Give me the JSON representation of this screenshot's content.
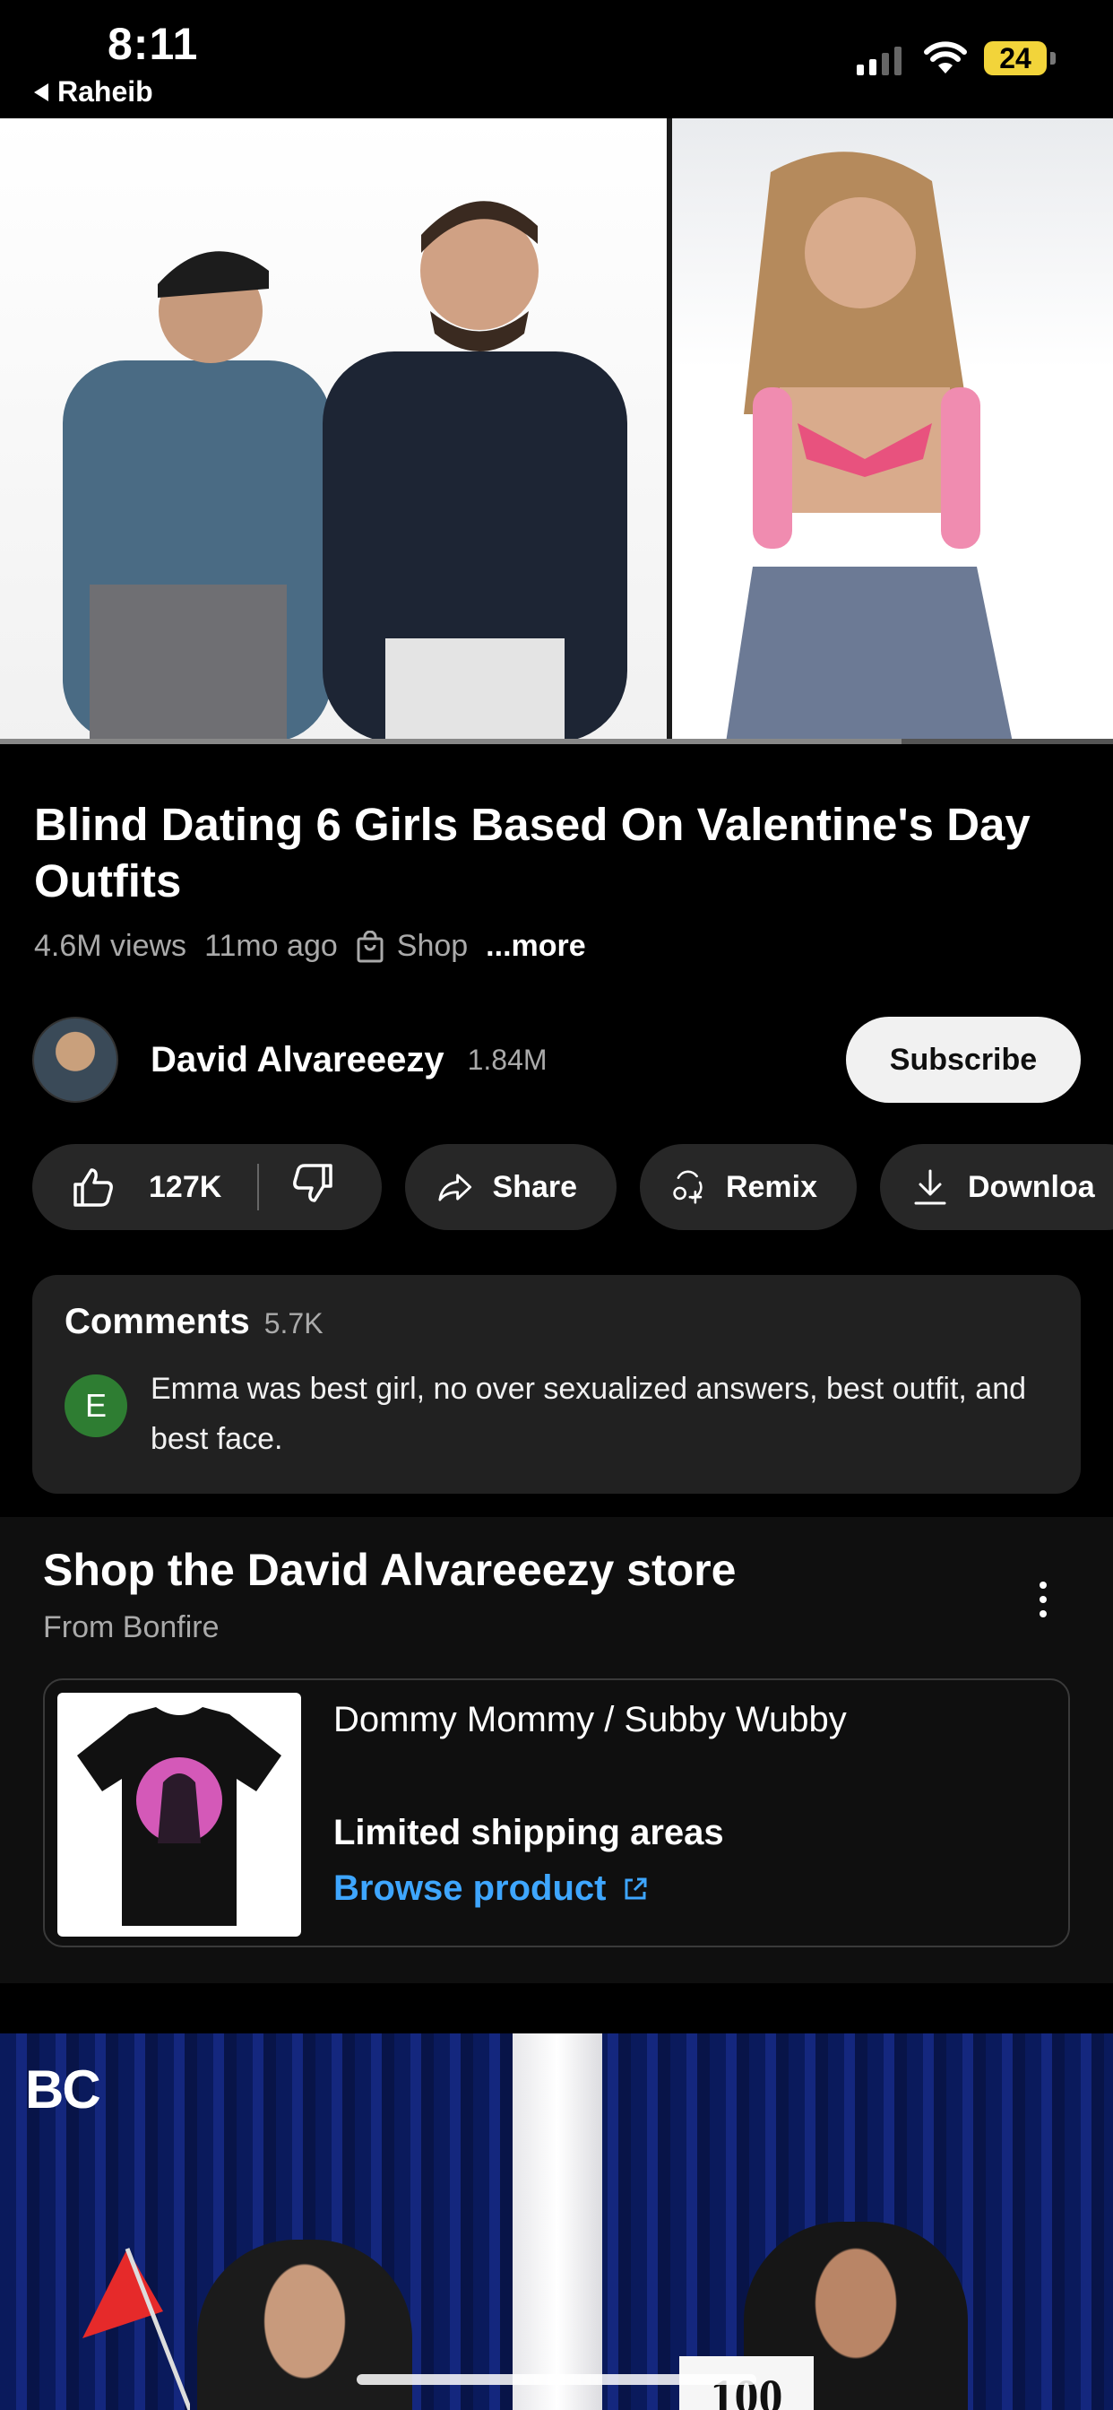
{
  "status_bar": {
    "time": "8:11",
    "back_app": "Raheib",
    "battery": "24"
  },
  "video": {
    "progress_fraction": 0.81
  },
  "title": "Blind Dating 6 Girls Based On Valentine's Day Outfits",
  "meta": {
    "views": "4.6M views",
    "age": "11mo ago",
    "shop": "Shop",
    "more": "...more"
  },
  "channel": {
    "name": "David Alvareeezy",
    "subscribers": "1.84M",
    "subscribe_label": "Subscribe"
  },
  "actions": {
    "likes": "127K",
    "share": "Share",
    "remix": "Remix",
    "download": "Downloa"
  },
  "comments": {
    "label": "Comments",
    "count": "5.7K",
    "avatar_letter": "E",
    "top_comment": "Emma was best girl, no over sexualized answers, best outfit, and best face."
  },
  "shop_section": {
    "title": "Shop the David Alvareeezy store",
    "subtitle": "From Bonfire",
    "product_name": "Dommy Mommy / Subby Wubby",
    "shipping": "Limited shipping areas",
    "browse": "Browse product"
  },
  "next_video": {
    "logo": "BC",
    "card": "100"
  },
  "colors": {
    "background": "#000000",
    "pill": "#272727",
    "card": "#212121",
    "link": "#3ea6ff",
    "battery": "#f2d43a",
    "avatar_e": "#2e7d32"
  }
}
